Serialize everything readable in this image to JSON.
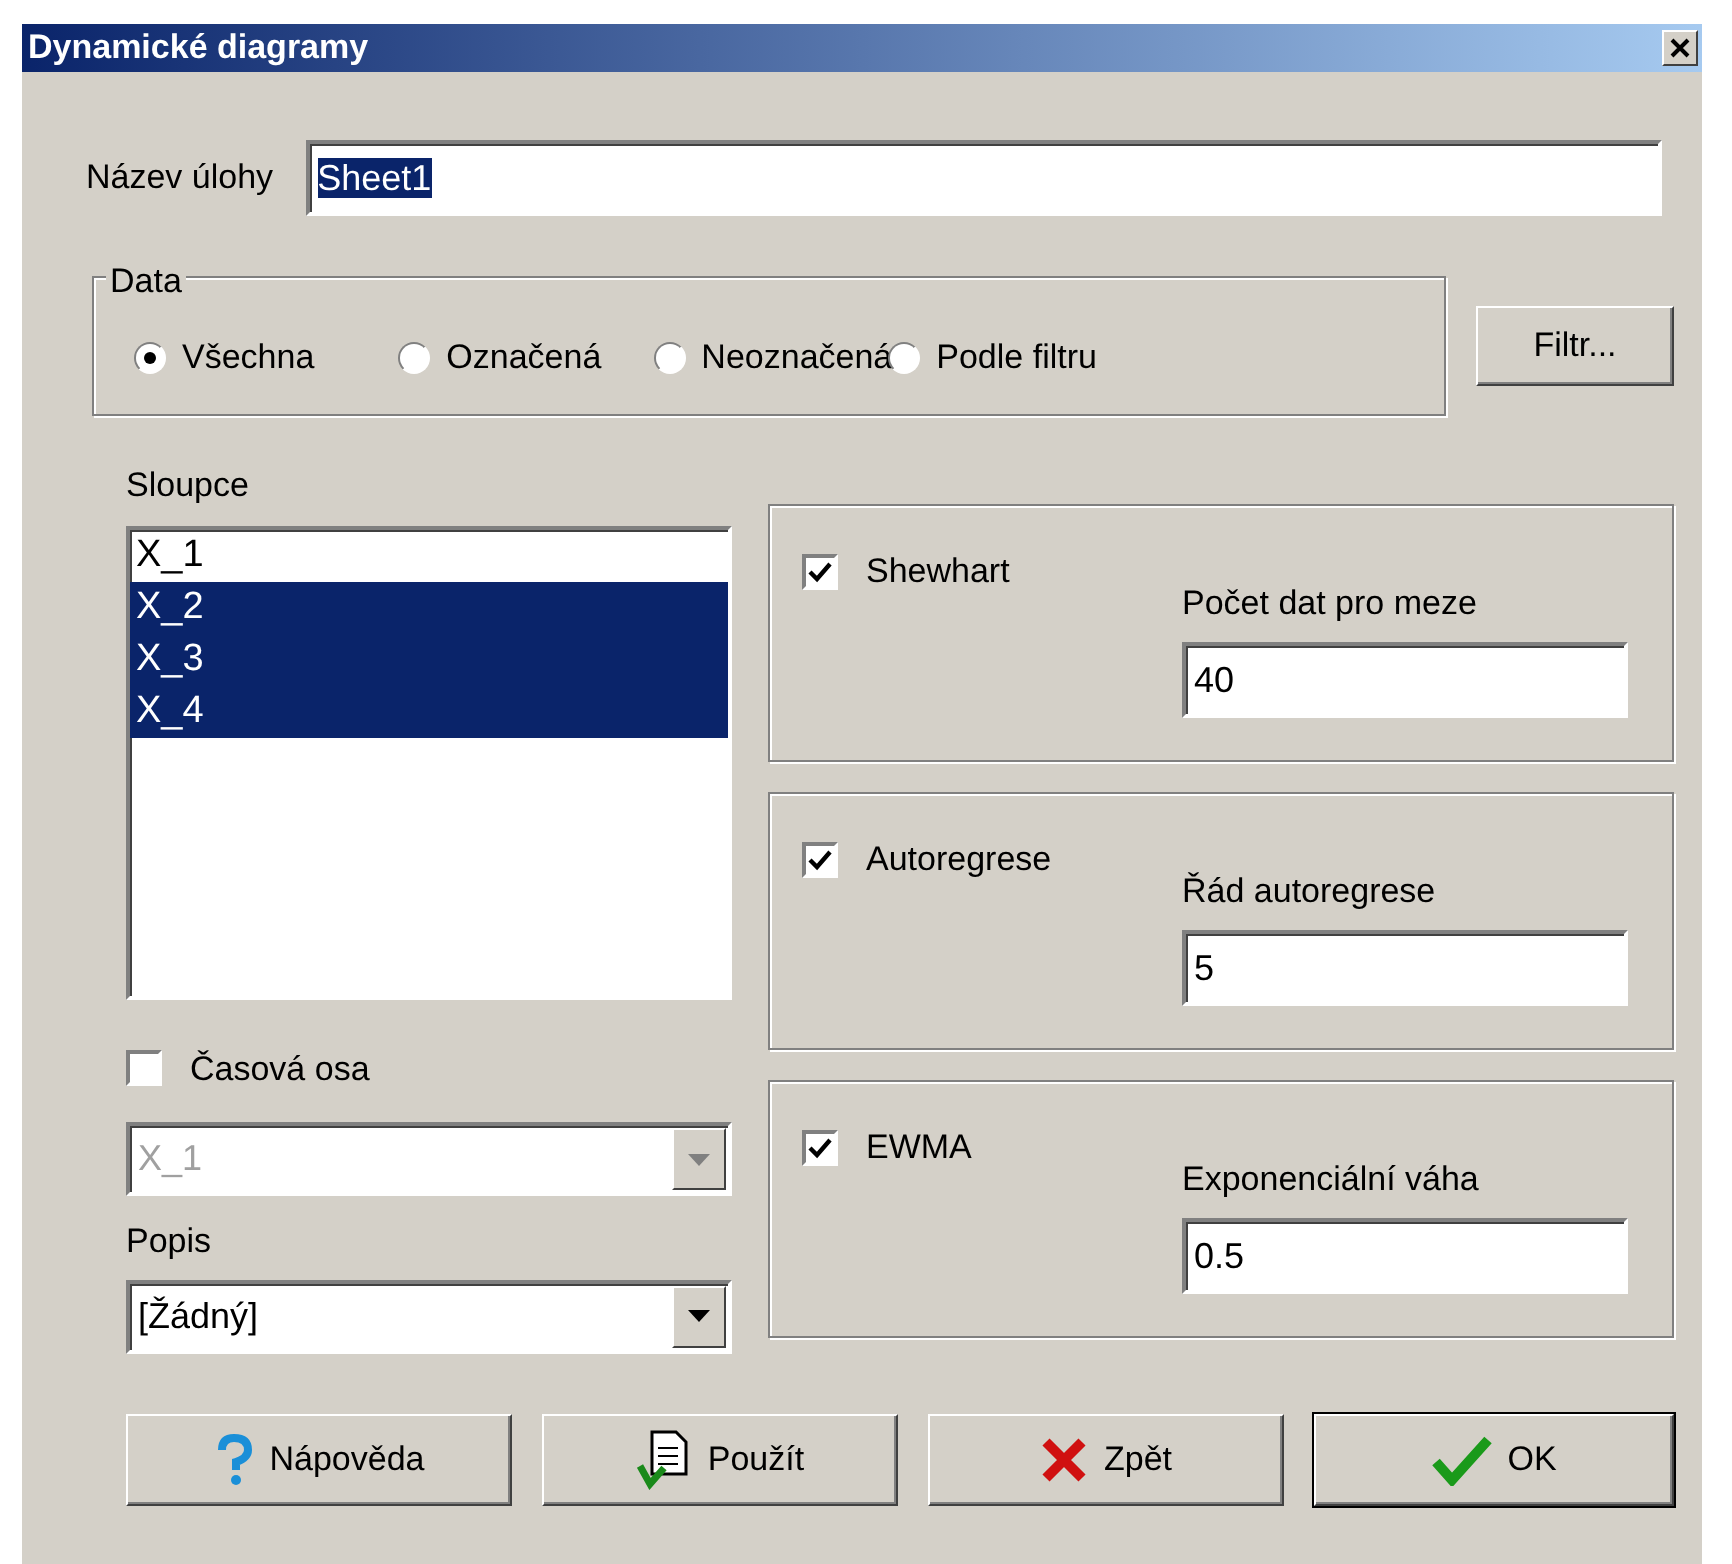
{
  "window": {
    "title": "Dynamické diagramy"
  },
  "task_name": {
    "label": "Název úlohy",
    "value": "Sheet1",
    "selected_text": true
  },
  "data_group": {
    "title": "Data",
    "options": [
      {
        "label": "Všechna",
        "selected": true
      },
      {
        "label": "Označená",
        "selected": false
      },
      {
        "label": "Neoznačená",
        "selected": false
      },
      {
        "label": "Podle filtru",
        "selected": false
      }
    ],
    "filter_button": "Filtr..."
  },
  "columns": {
    "label": "Sloupce",
    "items": [
      {
        "label": "X_1",
        "selected": false
      },
      {
        "label": "X_2",
        "selected": true
      },
      {
        "label": "X_3",
        "selected": true
      },
      {
        "label": "X_4",
        "selected": true
      }
    ]
  },
  "time_axis": {
    "label": "Časová osa",
    "checked": false,
    "value": "X_1",
    "disabled": true
  },
  "description": {
    "label": "Popis",
    "value": "[Žádný]",
    "disabled": false
  },
  "charts": [
    {
      "label": "Shewhart",
      "checked": true,
      "field_label": "Počet dat pro meze",
      "value": "40"
    },
    {
      "label": "Autoregrese",
      "checked": true,
      "field_label": "Řád autoregrese",
      "value": "5"
    },
    {
      "label": "EWMA",
      "checked": true,
      "field_label": "Exponenciální váha",
      "value": "0.5"
    }
  ],
  "buttons": [
    {
      "kind": "help",
      "label": "Nápověda",
      "default": false
    },
    {
      "kind": "apply",
      "label": "Použít",
      "default": false
    },
    {
      "kind": "cancel",
      "label": "Zpět",
      "default": false
    },
    {
      "kind": "ok",
      "label": "OK",
      "default": true
    }
  ]
}
